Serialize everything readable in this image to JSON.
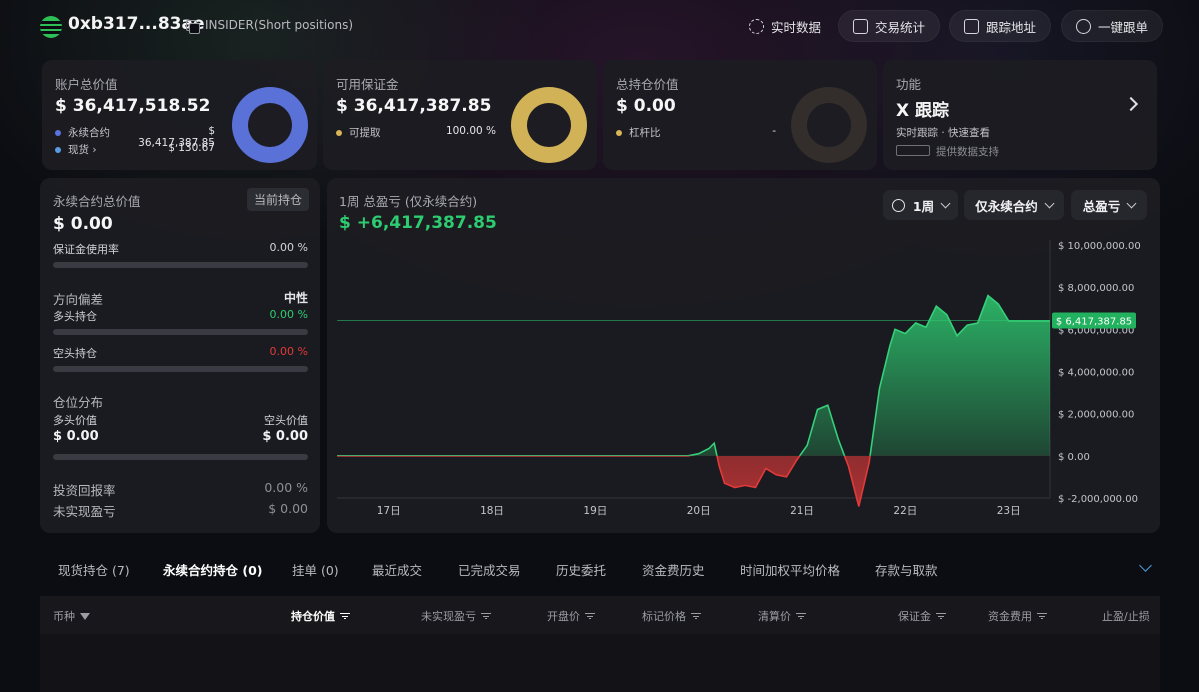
{
  "header": {
    "address": "0xb317...83ae",
    "tag": "INSIDER(Short positions)",
    "buttons": [
      {
        "label": "实时数据",
        "icon": "refresh-icon"
      },
      {
        "label": "交易统计",
        "icon": "stats-icon"
      },
      {
        "label": "跟踪地址",
        "icon": "monitor-icon"
      },
      {
        "label": "一键跟单",
        "icon": "copy-trade-icon"
      }
    ]
  },
  "summary": {
    "account": {
      "title": "账户总价值",
      "value": "$ 36,417,518.52",
      "rows": [
        {
          "label": "永续合约",
          "value": "$ 36,417,387.85",
          "color": "#5b73e0"
        },
        {
          "label": "现货 ›",
          "value": "$ 130.67",
          "color": "#5b9be0"
        }
      ],
      "donut_color": "#5a72d8",
      "donut_fill": 1.0
    },
    "margin": {
      "title": "可用保证金",
      "value": "$ 36,417,387.85",
      "rows": [
        {
          "label": "可提取",
          "value": "100.00 %",
          "color": "#d8b556"
        }
      ],
      "donut_color": "#d2b257",
      "donut_fill": 1.0
    },
    "position": {
      "title": "总持仓价值",
      "value": "$ 0.00",
      "rows": [
        {
          "label": "杠杆比",
          "value": "-",
          "color": "#d8b556"
        }
      ],
      "donut_color": "#332d2b",
      "donut_fill": 0.0
    },
    "feature": {
      "title": "功能",
      "headline": "X 跟踪",
      "sub": "实时跟踪 · 快速查看",
      "powered": "提供数据支持"
    }
  },
  "perp_panel": {
    "title": "永续合约总价值",
    "badge": "当前持仓",
    "value": "$ 0.00",
    "margin_usage_label": "保证金使用率",
    "margin_usage_value": "0.00 %",
    "margin_usage": 0,
    "bias_label": "方向偏差",
    "bias_value": "中性",
    "long_label": "多头持仓",
    "long_value": "0.00 %",
    "long_pct": 0,
    "short_label": "空头持仓",
    "short_value": "0.00 %",
    "short_pct": 0,
    "dist_label": "仓位分布",
    "long_val_label": "多头价值",
    "long_val": "$ 0.00",
    "short_val_label": "空头价值",
    "short_val": "$ 0.00",
    "roi_label": "投资回报率",
    "roi_value": "0.00 %",
    "unreal_label": "未实现盈亏",
    "unreal_value": "$ 0.00"
  },
  "pnl": {
    "title": "1周 总盈亏 (仅永续合约)",
    "value": "$ +6,417,387.85",
    "controls": [
      "1周",
      "仅永续合约",
      "总盈亏"
    ],
    "current_label": "$ 6,417,387.85"
  },
  "chart_data": {
    "type": "area",
    "title": "1周 总盈亏 (仅永续合约)",
    "x_ticks": [
      "17日",
      "18日",
      "19日",
      "20日",
      "21日",
      "22日",
      "23日"
    ],
    "y_ticks": [
      "$ 10,000,000.00",
      "$ 8,000,000.00",
      "$ 6,000,000.00",
      "$ 4,000,000.00",
      "$ 2,000,000.00",
      "$ 0.00",
      "$ -2,000,000.00"
    ],
    "ylim": [
      -2000000,
      10000000
    ],
    "x": [
      16.6,
      17.0,
      17.5,
      18.0,
      18.5,
      19.0,
      19.5,
      20.0,
      20.1,
      20.2,
      20.25,
      20.3,
      20.35,
      20.45,
      20.55,
      20.65,
      20.75,
      20.85,
      20.95,
      21.05,
      21.15,
      21.25,
      21.35,
      21.45,
      21.55,
      21.65,
      21.75,
      21.85,
      21.95,
      22.0,
      22.1,
      22.2,
      22.3,
      22.4,
      22.5,
      22.6,
      22.7,
      22.8,
      22.9,
      23.0,
      23.1,
      23.2,
      23.3,
      23.4,
      23.5
    ],
    "y": [
      0,
      0,
      0,
      0,
      0,
      0,
      0,
      0,
      100000,
      350000,
      600000,
      -500000,
      -1300000,
      -1500000,
      -1400000,
      -1500000,
      -600000,
      -900000,
      -1000000,
      -200000,
      500000,
      2200000,
      2400000,
      800000,
      -500000,
      -2400000,
      -300000,
      3200000,
      5200000,
      6000000,
      5800000,
      6300000,
      6100000,
      7100000,
      6700000,
      5700000,
      6200000,
      6300000,
      7600000,
      7200000,
      6400000,
      6400000,
      6400000,
      6400000,
      6400000
    ],
    "current": 6417387.85,
    "grid": false
  },
  "tabs": [
    {
      "label": "现货持仓 (7)",
      "active": false
    },
    {
      "label": "永续合约持仓 (0)",
      "active": true
    },
    {
      "label": "挂单 (0)",
      "active": false
    },
    {
      "label": "最近成交",
      "active": false
    },
    {
      "label": "已完成交易",
      "active": false
    },
    {
      "label": "历史委托",
      "active": false
    },
    {
      "label": "资金费历史",
      "active": false
    },
    {
      "label": "时间加权平均价格",
      "active": false
    },
    {
      "label": "存款与取款",
      "active": false
    }
  ],
  "table": {
    "columns": [
      {
        "label": "币种",
        "filter": true
      },
      {
        "label": "持仓价值",
        "active": true,
        "sort": true
      },
      {
        "label": "未实现盈亏",
        "sort": true
      },
      {
        "label": "开盘价",
        "sort": true
      },
      {
        "label": "标记价格",
        "sort": true
      },
      {
        "label": "清算价",
        "sort": true
      },
      {
        "label": "保证金",
        "sort": true
      },
      {
        "label": "资金费用",
        "sort": true
      },
      {
        "label": "止盈/止损"
      }
    ]
  },
  "colors": {
    "positive": "#2ecc71",
    "negative": "#e23a3a",
    "neutral_line": "#58b85e"
  }
}
